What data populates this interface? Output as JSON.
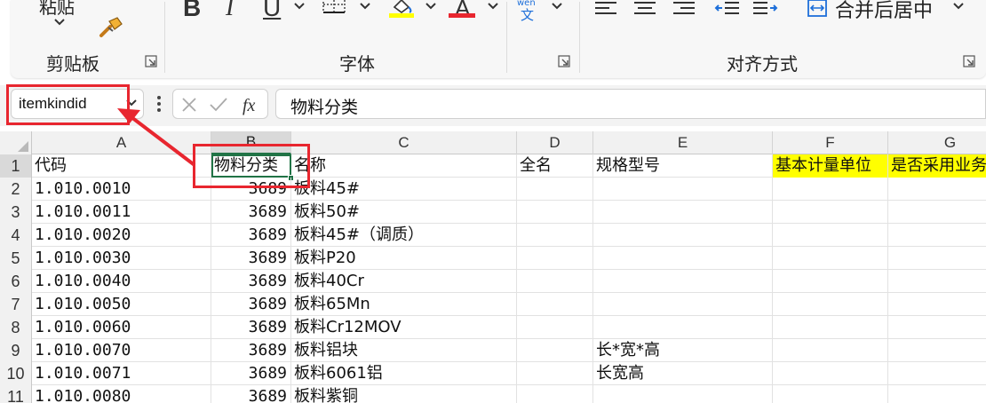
{
  "ribbon": {
    "clipboard": {
      "paste_label": "粘贴",
      "group_label": "剪贴板"
    },
    "font": {
      "bold_label": "B",
      "italic_label": "I",
      "underline_label": "U",
      "font_color_label": "A",
      "wen_label": "wén",
      "wen_char": "文",
      "group_label": "字体",
      "highlight_color": "#ffff00",
      "font_color": "#e8262f"
    },
    "alignment": {
      "merge_center_label": "合并后居中",
      "group_label": "对齐方式"
    }
  },
  "formula_bar": {
    "name_box": "itemkindid",
    "value": "物料分类"
  },
  "grid": {
    "columns": [
      "A",
      "B",
      "C",
      "D",
      "E",
      "F",
      "G"
    ],
    "selected_column": "B",
    "rows": [
      {
        "n": "1",
        "A": "代码",
        "B": "物料分类",
        "C": "名称",
        "D": "全名",
        "E": "规格型号",
        "F": "基本计量单位",
        "G": "是否采用业务"
      },
      {
        "n": "2",
        "A": "1.010.0010",
        "B": "3689",
        "C": "板料45#",
        "D": "",
        "E": "",
        "F": "",
        "G": ""
      },
      {
        "n": "3",
        "A": "1.010.0011",
        "B": "3689",
        "C": "板料50#",
        "D": "",
        "E": "",
        "F": "",
        "G": ""
      },
      {
        "n": "4",
        "A": "1.010.0020",
        "B": "3689",
        "C": "板料45#（调质）",
        "D": "",
        "E": "",
        "F": "",
        "G": ""
      },
      {
        "n": "5",
        "A": "1.010.0030",
        "B": "3689",
        "C": "板料P20",
        "D": "",
        "E": "",
        "F": "",
        "G": ""
      },
      {
        "n": "6",
        "A": "1.010.0040",
        "B": "3689",
        "C": "板料40Cr",
        "D": "",
        "E": "",
        "F": "",
        "G": ""
      },
      {
        "n": "7",
        "A": "1.010.0050",
        "B": "3689",
        "C": "板料65Mn",
        "D": "",
        "E": "",
        "F": "",
        "G": ""
      },
      {
        "n": "8",
        "A": "1.010.0060",
        "B": "3689",
        "C": "板料Cr12MOV",
        "D": "",
        "E": "",
        "F": "",
        "G": ""
      },
      {
        "n": "9",
        "A": "1.010.0070",
        "B": "3689",
        "C": "板料铝块",
        "D": "",
        "E": "长*宽*高",
        "F": "",
        "G": ""
      },
      {
        "n": "10",
        "A": "1.010.0071",
        "B": "3689",
        "C": "板料6061铝",
        "D": "",
        "E": "长宽高",
        "F": "",
        "G": ""
      },
      {
        "n": "11",
        "A": "1.010.0080",
        "B": "3689",
        "C": "板料紫铜",
        "D": "",
        "E": "",
        "F": "",
        "G": ""
      }
    ],
    "header_fill_color": "#ffff00",
    "annotation_color": "#e8262f",
    "selection_color": "#217346"
  }
}
